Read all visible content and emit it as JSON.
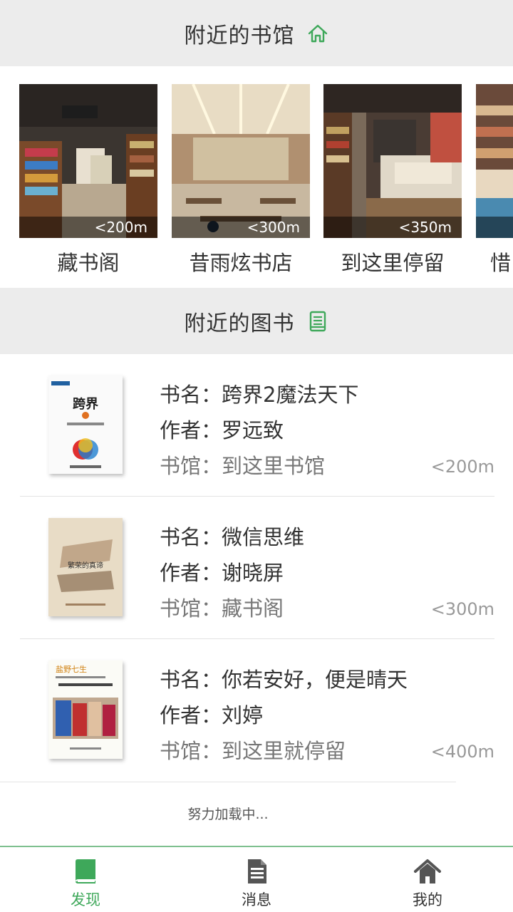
{
  "libraries_section": {
    "title": "附近的书馆",
    "icon": "home-icon",
    "accent": "#3ea85a",
    "items": [
      {
        "name": "藏书阁",
        "distance": "<200m"
      },
      {
        "name": "昔雨炫书店",
        "distance": "<300m"
      },
      {
        "name": "到这里停留",
        "distance": "<350m"
      },
      {
        "name": "惜",
        "distance": ""
      }
    ]
  },
  "books_section": {
    "title": "附近的图书",
    "icon": "document-icon",
    "items": [
      {
        "title": "书名：跨界2魔法天下",
        "author": "作者：罗远致",
        "library": "书馆：到这里书馆",
        "distance": "<200m",
        "cover": "cover-kuajie"
      },
      {
        "title": "书名：微信思维",
        "author": "作者：谢晓屏",
        "library": "书馆：藏书阁",
        "distance": "<300m",
        "cover": "cover-capitalism"
      },
      {
        "title": "书名：你若安好，便是晴天",
        "author": "作者：刘婷",
        "library": "书馆：到这里就停留",
        "distance": "<400m",
        "cover": "cover-yeshi"
      }
    ]
  },
  "loading_text": "努力加载中...",
  "tabbar": {
    "active_color": "#3ea85a",
    "tabs": [
      {
        "label": "发现",
        "icon": "book-icon",
        "active": true
      },
      {
        "label": "消息",
        "icon": "message-document-icon",
        "active": false
      },
      {
        "label": "我的",
        "icon": "home-icon",
        "active": false
      }
    ]
  }
}
